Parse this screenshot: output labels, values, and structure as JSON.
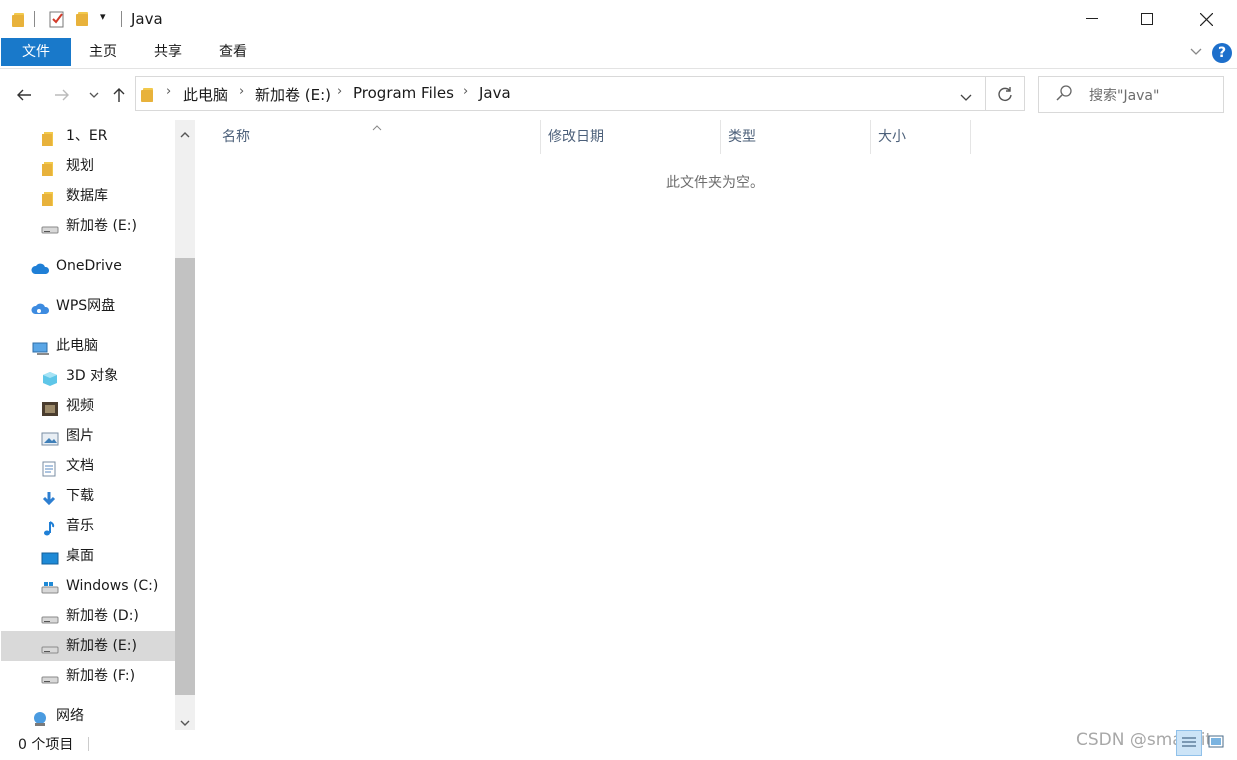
{
  "window": {
    "title": "Java"
  },
  "ribbon": {
    "tabs": [
      "文件",
      "主页",
      "共享",
      "查看"
    ]
  },
  "address": {
    "crumbs": [
      "此电脑",
      "新加卷 (E:)",
      "Program Files",
      "Java"
    ]
  },
  "search": {
    "placeholder": "搜索\"Java\""
  },
  "sidebar": {
    "items": [
      {
        "label": "1、ER",
        "icon": "folder-icon"
      },
      {
        "label": "规划",
        "icon": "folder-icon"
      },
      {
        "label": "数据库",
        "icon": "folder-icon"
      },
      {
        "label": "新加卷 (E:)",
        "icon": "drive-icon"
      },
      {
        "label": "OneDrive",
        "icon": "onedrive-icon"
      },
      {
        "label": "WPS网盘",
        "icon": "wps-cloud-icon"
      },
      {
        "label": "此电脑",
        "icon": "computer-icon"
      },
      {
        "label": "3D 对象",
        "icon": "3d-objects-icon"
      },
      {
        "label": "视频",
        "icon": "video-icon"
      },
      {
        "label": "图片",
        "icon": "pictures-icon"
      },
      {
        "label": "文档",
        "icon": "documents-icon"
      },
      {
        "label": "下载",
        "icon": "downloads-icon"
      },
      {
        "label": "音乐",
        "icon": "music-icon"
      },
      {
        "label": "桌面",
        "icon": "desktop-icon"
      },
      {
        "label": "Windows (C:)",
        "icon": "windows-drive-icon"
      },
      {
        "label": "新加卷 (D:)",
        "icon": "drive-icon"
      },
      {
        "label": "新加卷 (E:)",
        "icon": "drive-icon"
      },
      {
        "label": "新加卷 (F:)",
        "icon": "drive-icon"
      },
      {
        "label": "网络",
        "icon": "network-icon"
      }
    ]
  },
  "columns": [
    "名称",
    "修改日期",
    "类型",
    "大小"
  ],
  "content": {
    "empty_message": "此文件夹为空。"
  },
  "status": {
    "count_text": "0 个项目"
  },
  "watermark": "CSDN @smallFit",
  "colors": {
    "accent": "#1979ca",
    "selected": "#d9d9d9"
  }
}
